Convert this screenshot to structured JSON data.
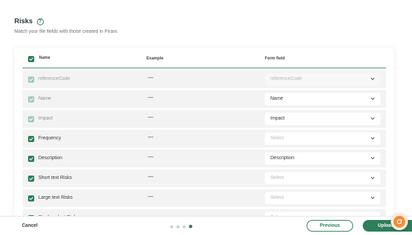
{
  "header": {
    "title": "Risks",
    "subtitle": "Match your file fields with those created in Pirani."
  },
  "table": {
    "columns": {
      "name": "Name",
      "example": "Example",
      "form_field": "Form field"
    },
    "rows": [
      {
        "name": "referenceCode",
        "example": "—",
        "form_field": "referenceCode",
        "state": "disabled"
      },
      {
        "name": "Name",
        "example": "—",
        "form_field": "Name",
        "state": "muted"
      },
      {
        "name": "Impact",
        "example": "—",
        "form_field": "Impact",
        "state": "muted"
      },
      {
        "name": "Frequency",
        "example": "—",
        "form_field": "Select",
        "state": "placeholder"
      },
      {
        "name": "Description",
        "example": "—",
        "form_field": "Description",
        "state": "normal"
      },
      {
        "name": "Short text Risks",
        "example": "—",
        "form_field": "Select",
        "state": "placeholder"
      },
      {
        "name": "Large text Risks",
        "example": "—",
        "form_field": "Select",
        "state": "placeholder"
      },
      {
        "name": "Single select Risks",
        "example": "—",
        "form_field": "Select",
        "state": "placeholder"
      }
    ]
  },
  "footer": {
    "cancel_label": "Cancel",
    "previous_label": "Previous",
    "upload_label": "Upload",
    "steps_total": 4,
    "step_current": 4
  },
  "colors": {
    "accent": "#2e7d5b",
    "row_bg": "#f3f3f3"
  }
}
